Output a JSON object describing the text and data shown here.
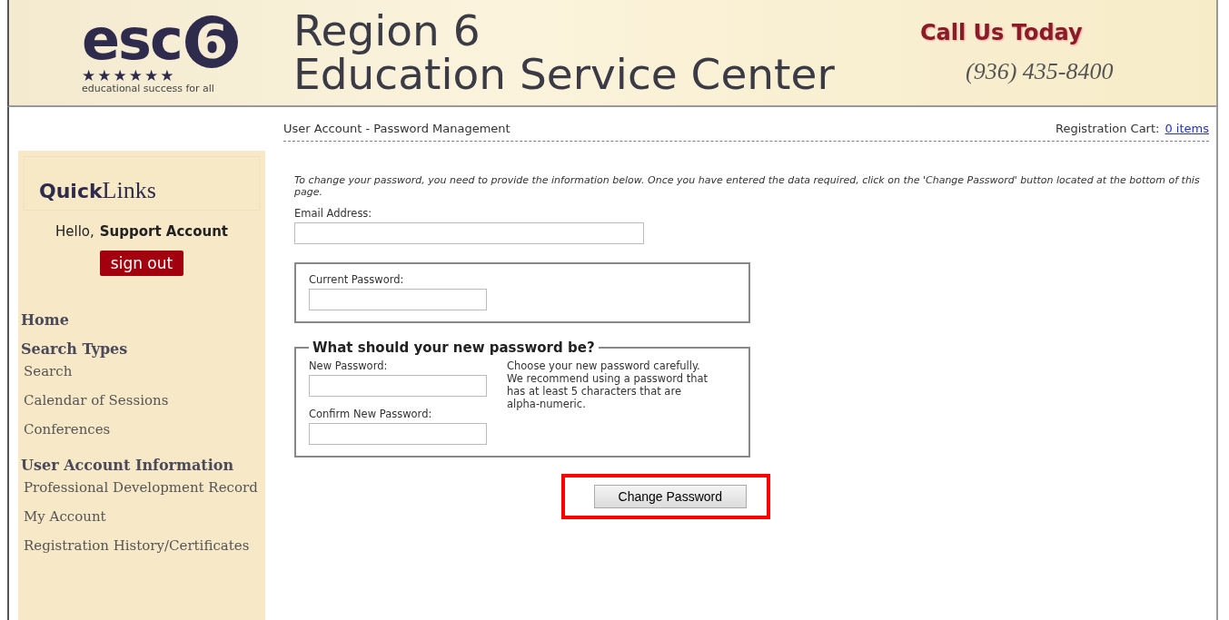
{
  "header": {
    "logo": {
      "letters": "esc",
      "digit": "6",
      "stars": "★★★★★★",
      "tagline": "educational success for all"
    },
    "title_lines": [
      "Region 6",
      "Education Service Center"
    ],
    "call": "Call Us Today",
    "phone": "(936) 435-8400"
  },
  "sidebar": {
    "title_bold": "Quick",
    "title_rest": "Links",
    "greeting": "Hello,",
    "user": "Support Account",
    "sign_out": "sign out",
    "items": [
      {
        "kind": "heading",
        "label": "Home"
      },
      {
        "kind": "heading",
        "label": "Search Types"
      },
      {
        "kind": "link",
        "label": "Search"
      },
      {
        "kind": "link",
        "label": "Calendar of Sessions"
      },
      {
        "kind": "link",
        "label": "Conferences"
      },
      {
        "kind": "heading",
        "label": "User Account Information"
      },
      {
        "kind": "link",
        "label": "Professional Development Record"
      },
      {
        "kind": "link",
        "label": "My Account"
      },
      {
        "kind": "link",
        "label": "Registration History/Certificates"
      }
    ]
  },
  "breadcrumb": "User Account - Password Management",
  "cart": {
    "label": "Registration Cart:",
    "link": "0 items"
  },
  "intro": "To change your password, you need to provide the information below. Once you have entered the data required, click on the 'Change Password' button located at the bottom of this page.",
  "email_label": "Email Address:",
  "current_label": "Current Password:",
  "new_group": {
    "legend": "What should your new password be?",
    "new_label": "New Password:",
    "confirm_label": "Confirm New Password:",
    "hint": "Choose your new password carefully. We recommend using a password that has at least 5 characters that are alpha-numeric."
  },
  "submit": {
    "label": "Change Password",
    "highlighted": true
  }
}
